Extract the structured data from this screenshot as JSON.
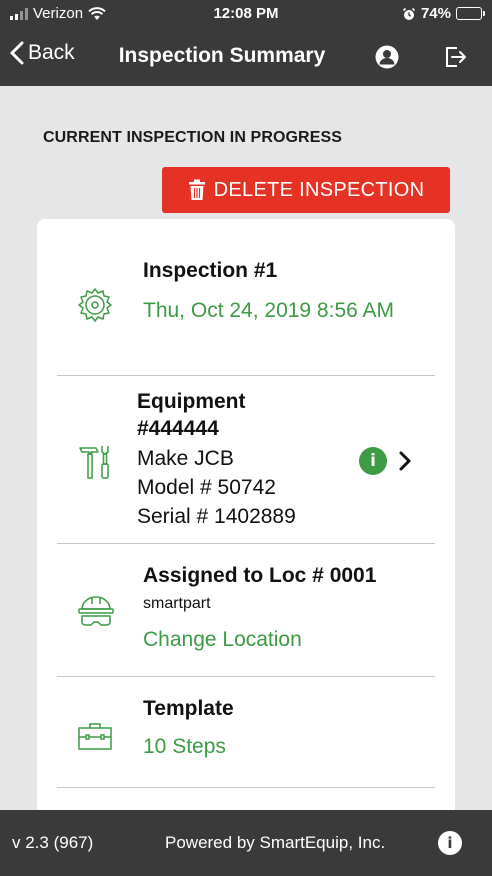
{
  "status_bar": {
    "carrier": "Verizon",
    "time": "12:08 PM",
    "battery": "74%",
    "battery_level": 0.74,
    "icons": [
      "signal-icon",
      "wifi-icon",
      "alarm-icon",
      "battery-icon"
    ]
  },
  "nav": {
    "back_label": "Back",
    "title": "Inspection Summary",
    "icons": [
      "chevron-left-icon",
      "user-icon",
      "logout-icon"
    ]
  },
  "section": {
    "heading": "CURRENT INSPECTION IN PROGRESS"
  },
  "delete_button": {
    "label": "DELETE INSPECTION",
    "icon": "trash-icon",
    "color": "#e53225"
  },
  "card": {
    "inspection": {
      "title": "Inspection #1",
      "datetime": "Thu, Oct 24, 2019 8:56 AM",
      "icon": "saw-blade-icon"
    },
    "equipment": {
      "title": "Equipment #444444",
      "make": "Make JCB",
      "model": "Model # 50742",
      "serial": "Serial # 1402889",
      "icon": "tools-icon",
      "info_glyph": "i"
    },
    "location": {
      "title": "Assigned to Loc # 0001",
      "subtitle": "smartpart",
      "action": "Change Location",
      "icon": "hardhat-goggles-icon"
    },
    "template": {
      "title": "Template",
      "steps": "10 Steps",
      "icon": "toolbox-icon"
    }
  },
  "footer": {
    "version": "v 2.3 (967)",
    "powered_by": "Powered by SmartEquip, Inc.",
    "info_glyph": "i"
  },
  "colors": {
    "bar_bg": "#3a3a3a",
    "page_bg": "#e6e6e6",
    "accent_green": "#3d9a45",
    "danger_red": "#e53225"
  }
}
